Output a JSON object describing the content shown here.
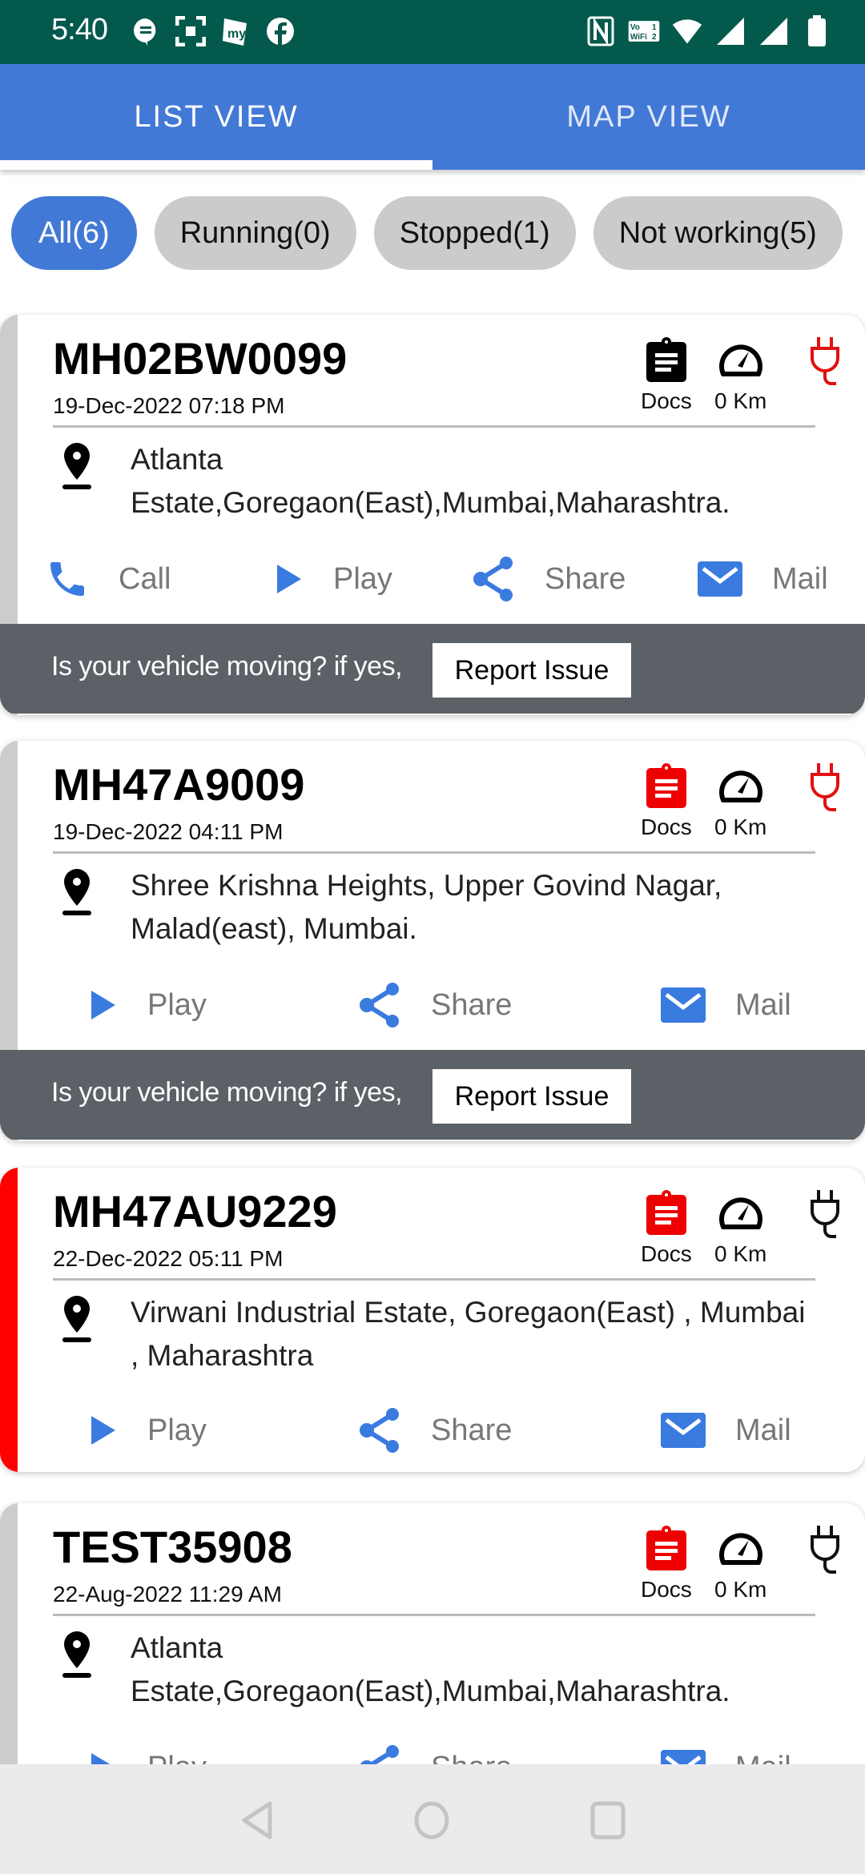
{
  "status_bar": {
    "time": "5:40",
    "left_icons": [
      "message-icon",
      "scanner-icon",
      "myapp-icon",
      "facebook-icon"
    ],
    "right_icons": [
      "nfc-icon",
      "vowifi-icon",
      "wifi-icon",
      "signal-icon",
      "signal-icon",
      "battery-icon"
    ],
    "vowifi_text": "Vo WiFi"
  },
  "tabs": [
    {
      "label": "LIST VIEW",
      "active": true
    },
    {
      "label": "MAP VIEW",
      "active": false
    }
  ],
  "filters": [
    {
      "label": "All(6)",
      "active": true
    },
    {
      "label": "Running(0)",
      "active": false
    },
    {
      "label": "Stopped(1)",
      "active": false
    },
    {
      "label": "Not working(5)",
      "active": false
    }
  ],
  "colors": {
    "primary": "#4279d6",
    "status_bar": "#03594c",
    "alert_red": "#ff0000",
    "report_bar": "#5c6167",
    "stripe_grey": "#cccccc"
  },
  "vehicles": [
    {
      "plate": "MH02BW0099",
      "datetime": "19-Dec-2022 07:18 PM",
      "docs_label": "Docs",
      "docs_status": "ok",
      "distance": "0 Km",
      "power_status": "disconnected",
      "address": "Atlanta Estate,Goregaon(East),Mumbai,Maharashtra.",
      "actions": [
        "Call",
        "Play",
        "Share",
        "Mail"
      ],
      "report_prompt": "Is your vehicle moving? if yes,",
      "report_button": "Report Issue",
      "stripe": "grey"
    },
    {
      "plate": "MH47A9009",
      "datetime": "19-Dec-2022 04:11 PM",
      "docs_label": "Docs",
      "docs_status": "expired",
      "distance": "0 Km",
      "power_status": "disconnected",
      "address": "Shree Krishna Heights, Upper Govind Nagar, Malad(east), Mumbai.",
      "actions": [
        "Play",
        "Share",
        "Mail"
      ],
      "report_prompt": "Is your vehicle moving? if yes,",
      "report_button": "Report Issue",
      "stripe": "grey"
    },
    {
      "plate": "MH47AU9229",
      "datetime": "22-Dec-2022 05:11 PM",
      "docs_label": "Docs",
      "docs_status": "expired",
      "distance": "0 Km",
      "power_status": "connected",
      "address": "Virwani Industrial Estate, Goregaon(East) , Mumbai , Maharashtra",
      "actions": [
        "Play",
        "Share",
        "Mail"
      ],
      "stripe": "red"
    },
    {
      "plate": "TEST35908",
      "datetime": "22-Aug-2022 11:29 AM",
      "docs_label": "Docs",
      "docs_status": "expired",
      "distance": "0 Km",
      "power_status": "connected",
      "address": "Atlanta Estate,Goregaon(East),Mumbai,Maharashtra.",
      "actions": [
        "Play",
        "Share",
        "Mail"
      ],
      "stripe": "grey"
    }
  ],
  "nav_bar": [
    "back-icon",
    "home-icon",
    "recents-icon"
  ]
}
